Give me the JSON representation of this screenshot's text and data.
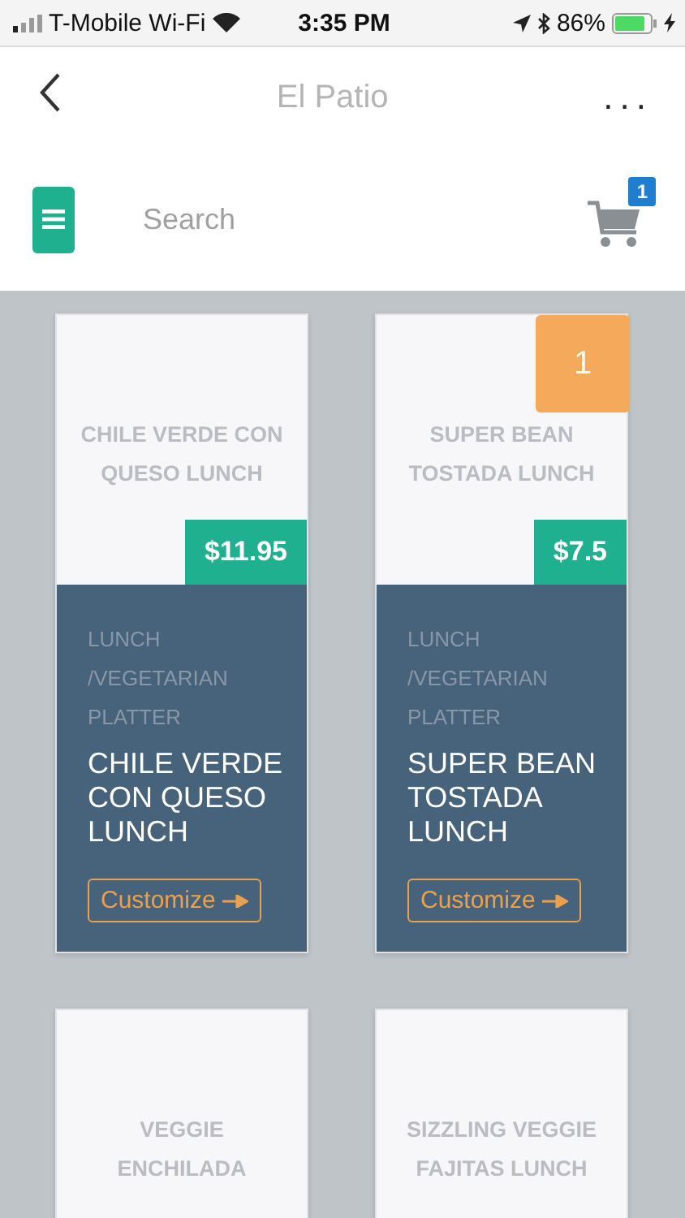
{
  "status_bar": {
    "carrier": "T-Mobile Wi-Fi",
    "time": "3:35 PM",
    "battery": "86%"
  },
  "header": {
    "title": "El Patio",
    "more": "..."
  },
  "toolbar": {
    "search": {
      "placeholder": "Search"
    },
    "cart_count": "1"
  },
  "rows": [
    {
      "items": [
        {
          "name": "CHILE VERDE CON QUESO LUNCH",
          "price": "$11.95",
          "category": "LUNCH /VEGETARIAN PLATTER",
          "title": "CHILE VERDE CON QUESO LUNCH",
          "action": "Customize"
        },
        {
          "name": "SUPER BEAN TOSTADA LUNCH",
          "price": "$7.5",
          "quantity": "1",
          "category": "LUNCH /VEGETARIAN PLATTER",
          "title": "SUPER BEAN TOSTADA LUNCH",
          "action": "Customize"
        }
      ]
    },
    {
      "items": [
        {
          "name": "VEGGIE ENCHILADA"
        },
        {
          "name": "SIZZLING VEGGIE FAJITAS LUNCH"
        }
      ]
    }
  ]
}
